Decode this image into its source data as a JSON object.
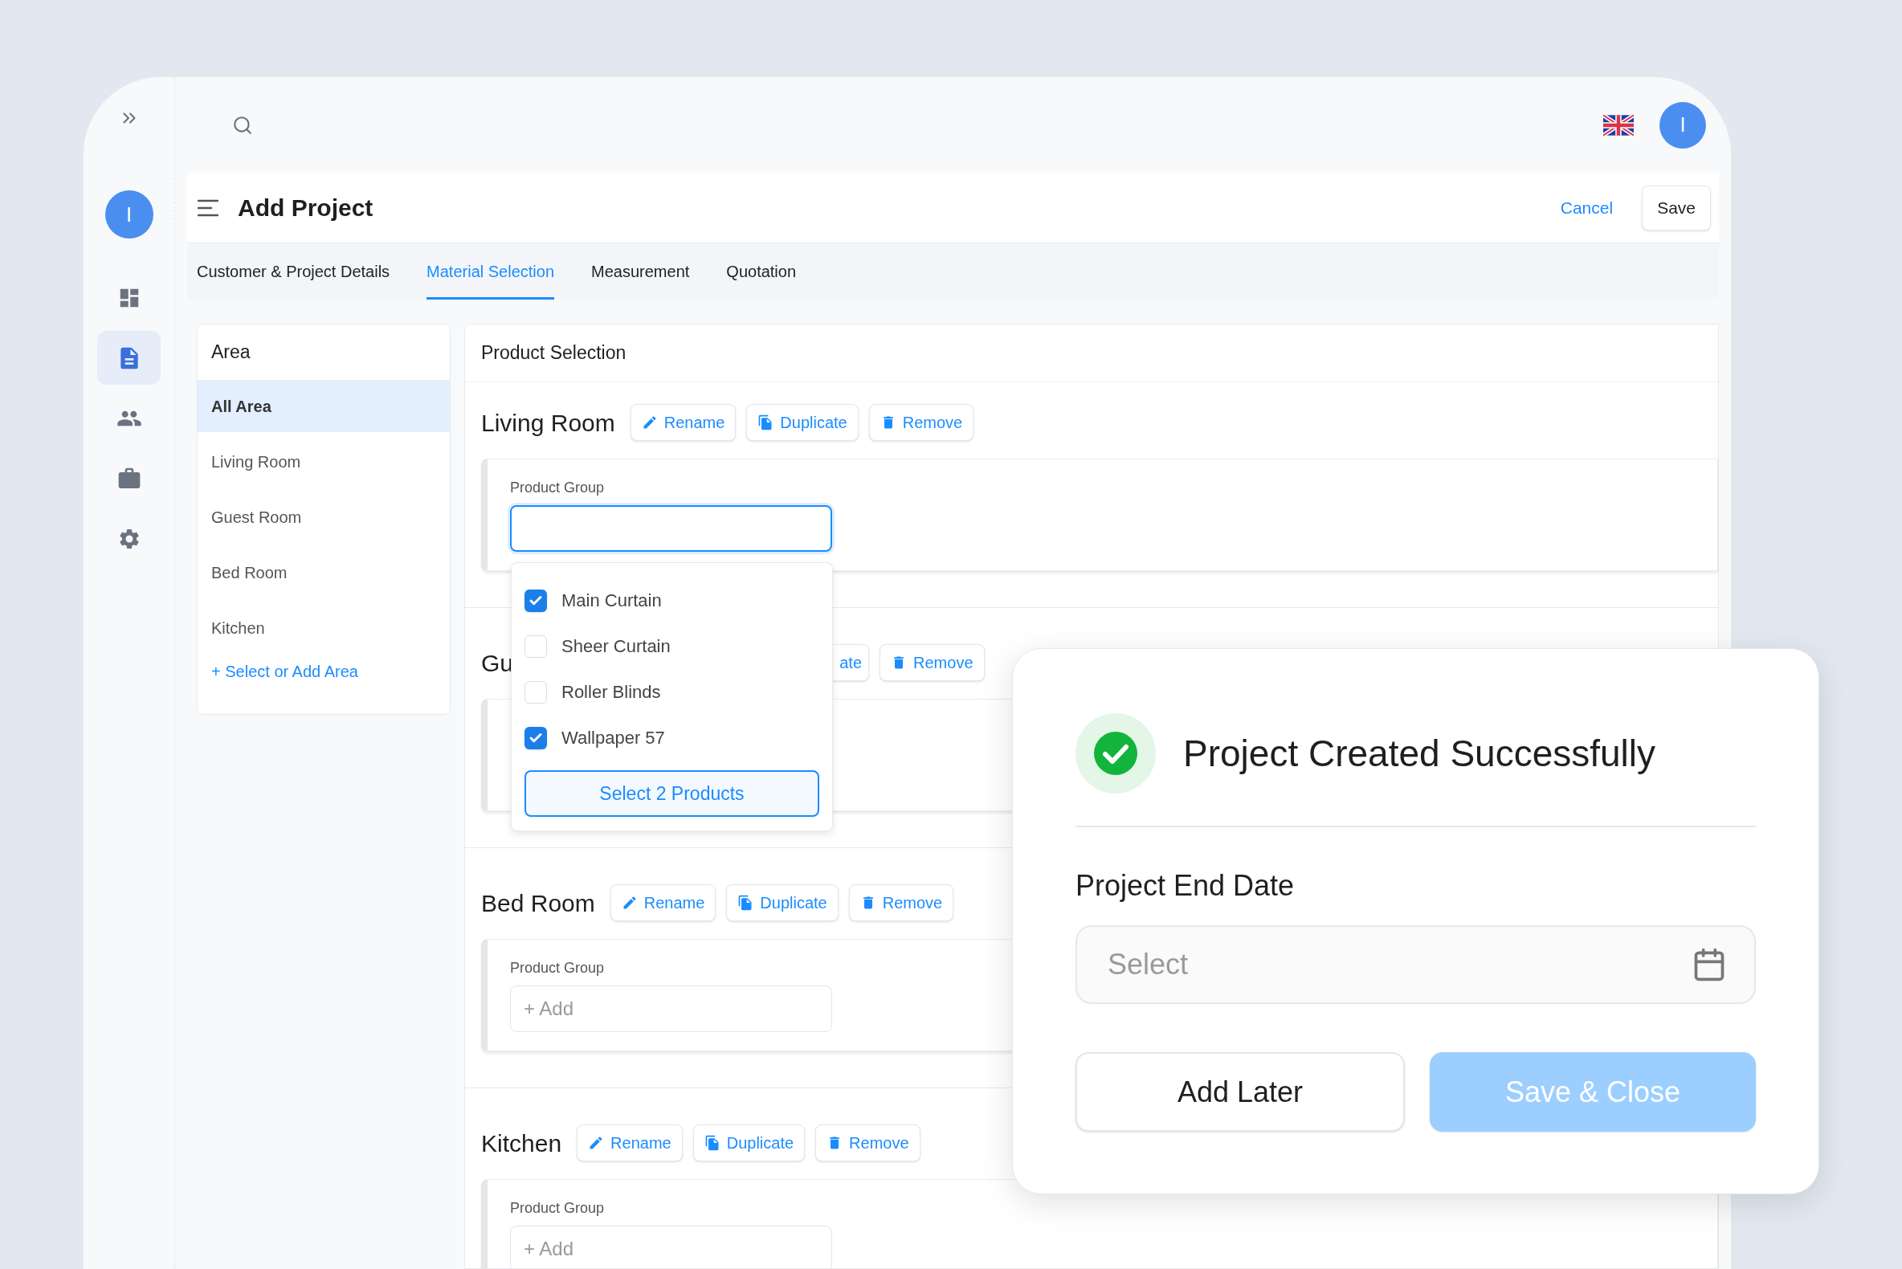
{
  "rail": {
    "avatar": "I",
    "items": [
      {
        "kind": "dashboard",
        "selected": false
      },
      {
        "kind": "document",
        "selected": true
      },
      {
        "kind": "people",
        "selected": false
      },
      {
        "kind": "briefcase",
        "selected": false
      },
      {
        "kind": "settings",
        "selected": false
      }
    ]
  },
  "topbar": {
    "avatar": "I"
  },
  "header": {
    "title": "Add Project",
    "cancel": "Cancel",
    "save": "Save"
  },
  "tabs": [
    {
      "label": "Customer & Project Details",
      "selected": false
    },
    {
      "label": "Material Selection",
      "selected": true
    },
    {
      "label": "Measurement",
      "selected": false
    },
    {
      "label": "Quotation",
      "selected": false
    }
  ],
  "area_panel": {
    "title": "Area",
    "items": [
      {
        "label": "All Area",
        "selected": true
      },
      {
        "label": "Living Room",
        "selected": false
      },
      {
        "label": "Guest Room",
        "selected": false
      },
      {
        "label": "Bed Room",
        "selected": false
      },
      {
        "label": "Kitchen",
        "selected": false
      }
    ],
    "add_link": "+ Select or Add Area"
  },
  "product_panel": {
    "title": "Product Selection",
    "sections": [
      {
        "title": "Living Room",
        "buttons": [
          {
            "kind": "rename",
            "label": "Rename",
            "cut": false
          },
          {
            "kind": "duplicate",
            "label": "Duplicate",
            "cut": false
          },
          {
            "kind": "remove",
            "label": "Remove",
            "cut": false
          }
        ],
        "field": {
          "label": "Product Group",
          "focused": true
        }
      },
      {
        "title": "Gu",
        "buttons": [
          {
            "kind": "duplicate",
            "label": "ate",
            "cut": true
          },
          {
            "kind": "remove",
            "label": "Remove",
            "cut": false
          }
        ]
      },
      {
        "title": "Bed Room",
        "buttons": [
          {
            "kind": "rename",
            "label": "Rename",
            "cut": false
          },
          {
            "kind": "duplicate",
            "label": "Duplicate",
            "cut": false
          },
          {
            "kind": "remove",
            "label": "Remove",
            "cut": false
          }
        ],
        "field": {
          "label": "Product Group",
          "placeholder": "+ Add",
          "focused": false
        }
      },
      {
        "title": "Kitchen",
        "buttons": [
          {
            "kind": "rename",
            "label": "Rename",
            "cut": false
          },
          {
            "kind": "duplicate",
            "label": "Duplicate",
            "cut": false
          },
          {
            "kind": "remove",
            "label": "Remove",
            "cut": false
          }
        ],
        "field": {
          "label": "Product Group",
          "placeholder": "+ Add",
          "focused": false
        }
      }
    ]
  },
  "dropdown": {
    "options": [
      {
        "label": "Main Curtain",
        "checked": true
      },
      {
        "label": "Sheer Curtain",
        "checked": false
      },
      {
        "label": "Roller Blinds",
        "checked": false
      },
      {
        "label": "Wallpaper 57",
        "checked": true
      }
    ],
    "button": "Select 2 Products"
  },
  "modal": {
    "title": "Project Created Successfully",
    "field_label": "Project End Date",
    "date_placeholder": "Select",
    "buttons": [
      {
        "kind": "secondary",
        "label": "Add Later",
        "disabled": false
      },
      {
        "kind": "primary",
        "label": "Save & Close",
        "disabled": true
      }
    ]
  }
}
